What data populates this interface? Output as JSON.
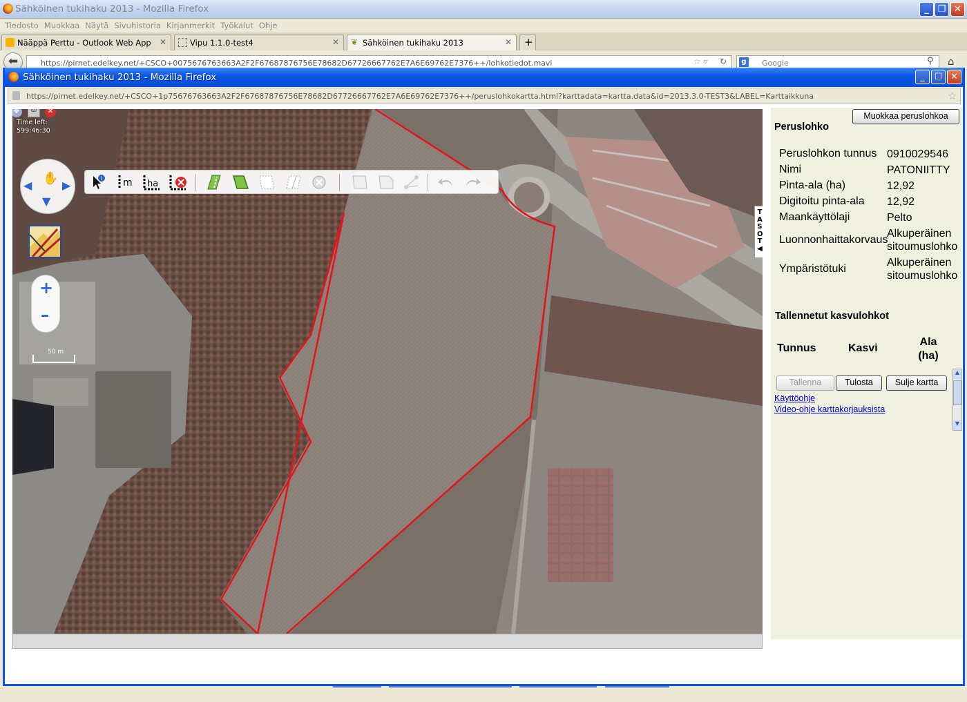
{
  "outer_window": {
    "title": "Sähköinen tukihaku 2013 - Mozilla Firefox",
    "menu": [
      "Tiedosto",
      "Muokkaa",
      "Näytä",
      "Sivuhistoria",
      "Kirjanmerkit",
      "Työkalut",
      "Ohje"
    ],
    "tabs": [
      {
        "label": "Nääppä Perttu - Outlook Web App"
      },
      {
        "label": "Vipu 1.1.0-test4"
      },
      {
        "label": "Sähköinen tukihaku 2013"
      }
    ],
    "new_tab": "+",
    "url": "https://pirnet.edelkey.net/+CSCO+0075676763663A2F2F67687876756E78682D67726667762E7A6E69762E7376++/lohkotiedot.mavi",
    "search_placeholder": "Google"
  },
  "popup": {
    "title": "Sähköinen tukihaku 2013 - Mozilla Firefox",
    "url": "https://pirnet.edelkey.net/+CSCO+1p75676763663A2F2F67687876756E78682D67726667762E7A6E69762E7376++/peruslohkokartta.html?karttadata=kartta.data&id=2013.3.0-TEST3&LABEL=Karttaikkuna"
  },
  "map": {
    "time_left_label": "Time left:",
    "time_left_value": "599:46:30",
    "tools": [
      {
        "name": "info-tool",
        "label": ""
      },
      {
        "name": "measure-distance-tool",
        "label": "m"
      },
      {
        "name": "measure-area-tool",
        "label": "ha"
      },
      {
        "name": "clear-measure-tool",
        "label": ""
      },
      {
        "name": "draw-line-tool",
        "label": ""
      },
      {
        "name": "draw-polygon-tool",
        "label": ""
      },
      {
        "name": "edit-vertices-tool",
        "label": ""
      },
      {
        "name": "split-tool",
        "label": ""
      },
      {
        "name": "delete-tool",
        "label": ""
      },
      {
        "name": "copy-tool",
        "label": ""
      },
      {
        "name": "merge-tool",
        "label": ""
      },
      {
        "name": "move-vertex-tool",
        "label": ""
      },
      {
        "name": "undo-tool",
        "label": ""
      },
      {
        "name": "redo-tool",
        "label": ""
      }
    ],
    "zoom_in": "+",
    "zoom_out": "–",
    "layers_tab": "TASOT◀",
    "scale_label": "50 m",
    "boundary_color": "#e4141b"
  },
  "panel": {
    "edit_button": "Muokkaa peruslohkoa",
    "heading": "Peruslohko",
    "rows": [
      {
        "label": "Peruslohkon tunnus",
        "value": "0910029546"
      },
      {
        "label": "Nimi",
        "value": "PATONIITTY"
      },
      {
        "label": "Pinta-ala (ha)",
        "value": "12,92"
      },
      {
        "label": "Digitoitu pinta-ala",
        "value": "12,92"
      },
      {
        "label": "Maankäyttölaji",
        "value": "Pelto"
      },
      {
        "label": "Luonnonhaittakorvaus",
        "value": "Alkuperäinen sitoumuslohko"
      },
      {
        "label": "Ympäristötuki",
        "value": "Alkuperäinen sitoumuslohko"
      }
    ],
    "crops_heading": "Tallennetut kasvulohkot",
    "crop_columns": [
      "Tunnus",
      "Kasvi",
      "Ala (ha)"
    ],
    "buttons": {
      "save": "Tallenna",
      "print": "Tulosta",
      "close": "Sulje kartta"
    },
    "links": {
      "manual": "Käyttöohje",
      "video": "Video-ohje karttakorjauksista"
    }
  }
}
